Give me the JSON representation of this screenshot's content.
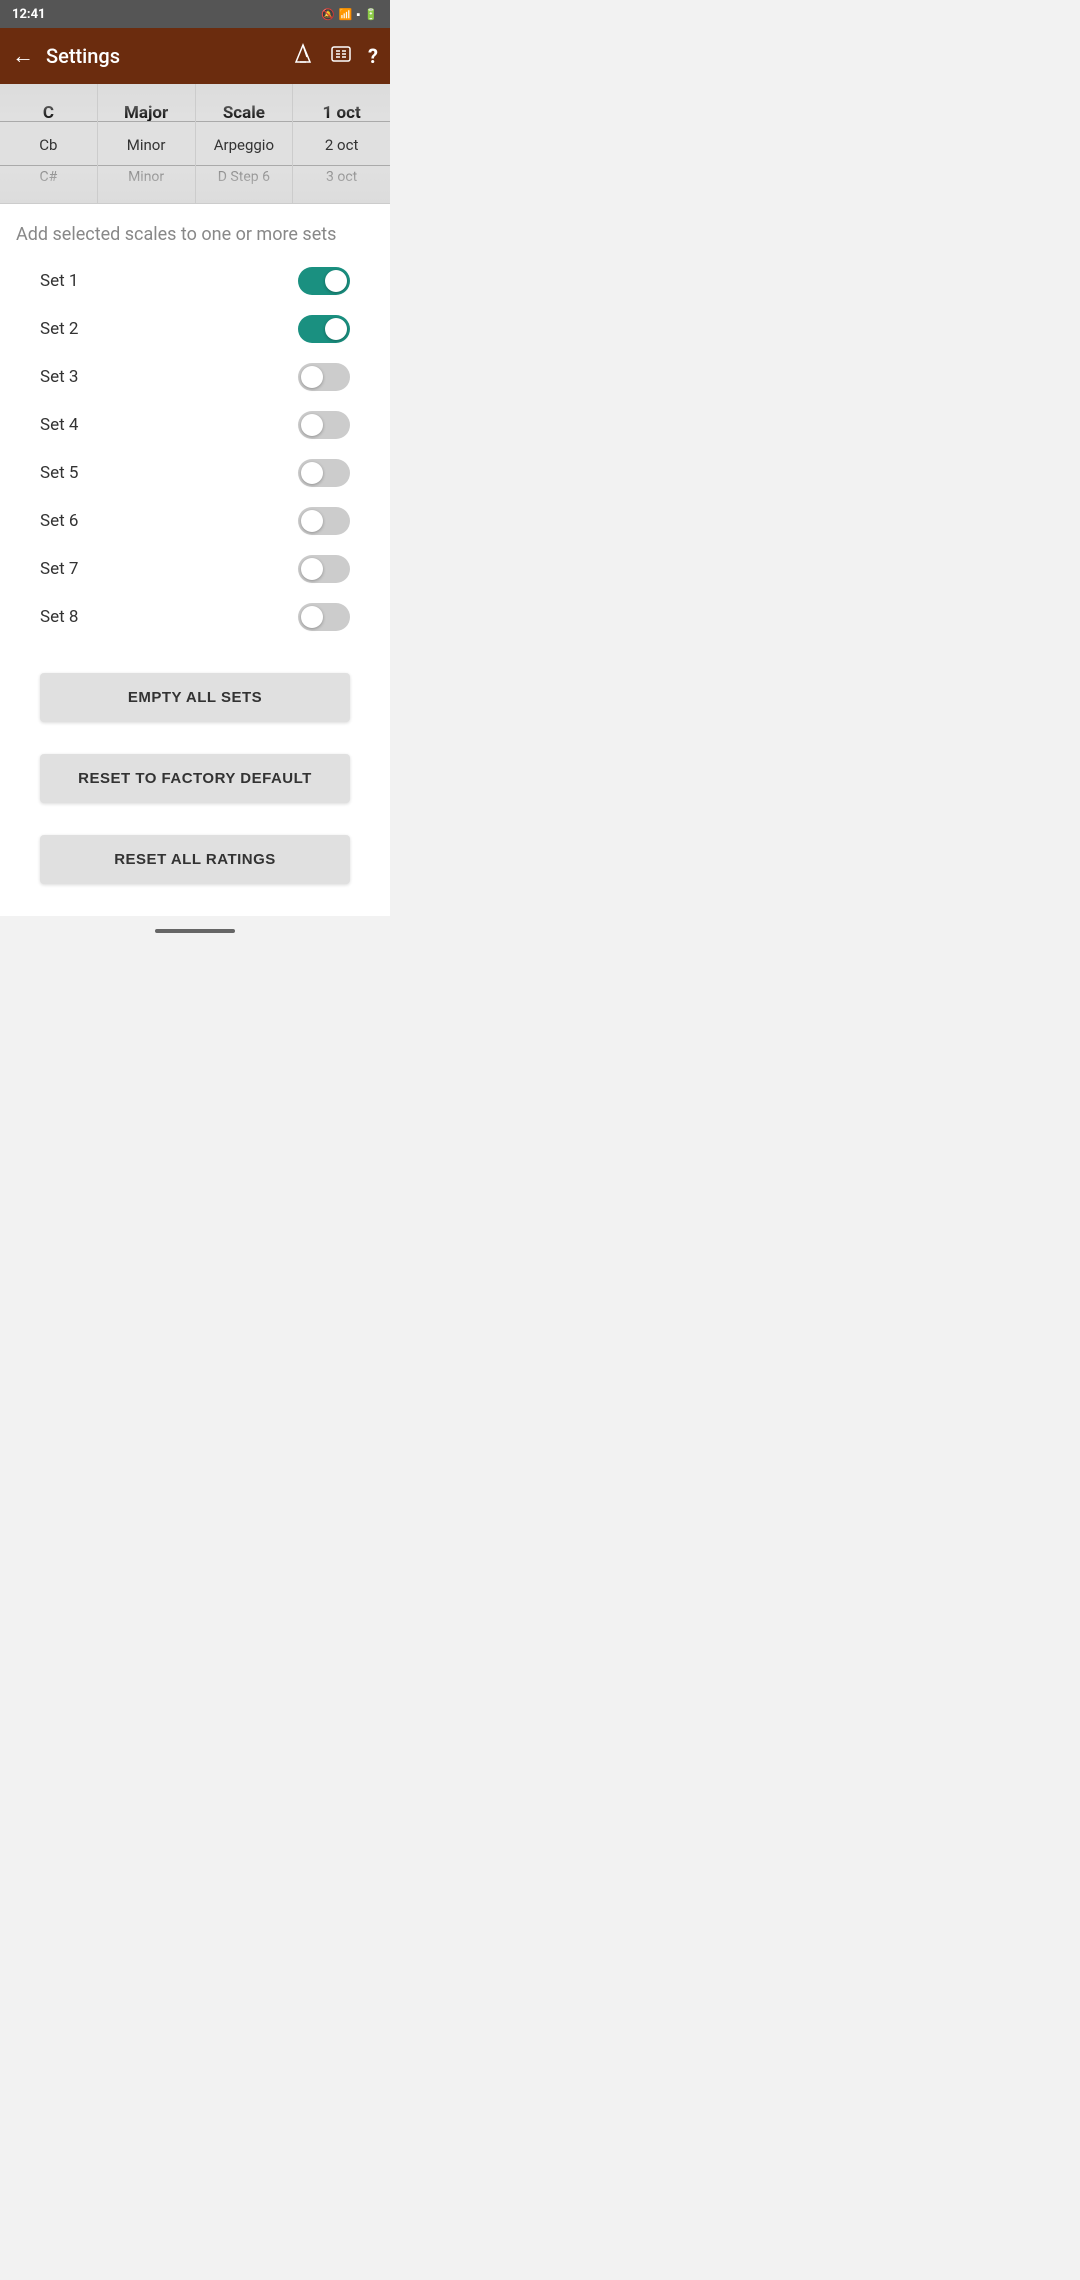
{
  "statusBar": {
    "time": "12:41",
    "icons": "📷 💬 📷 •"
  },
  "appBar": {
    "title": "Settings",
    "backLabel": "←",
    "icon1": "🎵",
    "icon2": "☰",
    "icon3": "?"
  },
  "picker": {
    "columns": [
      {
        "id": "note",
        "items": [
          "",
          "C",
          "Cb",
          "C#",
          ""
        ],
        "selected": "C"
      },
      {
        "id": "type",
        "items": [
          "",
          "Major",
          "Minor",
          "Minor",
          ""
        ],
        "selected": "Major"
      },
      {
        "id": "kind",
        "items": [
          "",
          "Scale",
          "Arpeggio",
          "D Step 6",
          ""
        ],
        "selected": "Scale"
      },
      {
        "id": "octave",
        "items": [
          "",
          "1 oct",
          "2 oct",
          "3 oct",
          ""
        ],
        "selected": "1 oct"
      }
    ]
  },
  "sectionTitle": "Add selected scales to one or more sets",
  "sets": [
    {
      "label": "Set 1",
      "on": true
    },
    {
      "label": "Set 2",
      "on": true
    },
    {
      "label": "Set 3",
      "on": false
    },
    {
      "label": "Set 4",
      "on": false
    },
    {
      "label": "Set 5",
      "on": false
    },
    {
      "label": "Set 6",
      "on": false
    },
    {
      "label": "Set 7",
      "on": false
    },
    {
      "label": "Set 8",
      "on": false
    }
  ],
  "buttons": {
    "emptyAllSets": "EMPTY ALL SETS",
    "resetToFactoryDefault": "RESET TO FACTORY DEFAULT",
    "resetAllRatings": "RESET ALL RATINGS"
  },
  "colors": {
    "toggleOn": "#1a9080",
    "toggleOff": "#cccccc",
    "appBar": "#6B2C0E",
    "buttonBg": "#e0e0e0"
  }
}
